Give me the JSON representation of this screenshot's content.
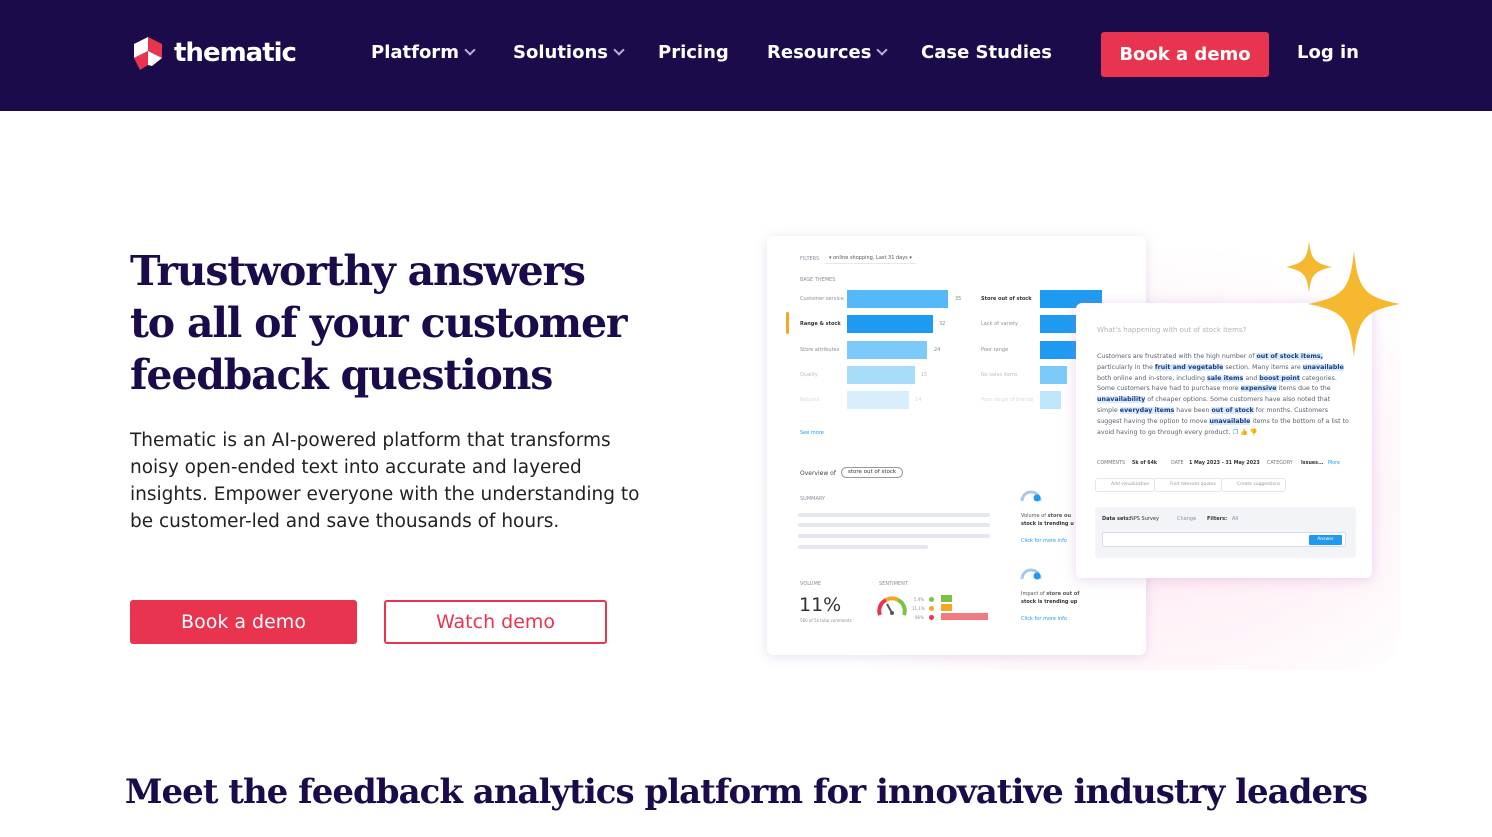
{
  "nav": {
    "logo_text": "thematic",
    "items": [
      {
        "label": "Platform",
        "dropdown": true
      },
      {
        "label": "Solutions",
        "dropdown": true
      },
      {
        "label": "Pricing",
        "dropdown": false
      },
      {
        "label": "Resources",
        "dropdown": true
      },
      {
        "label": "Case Studies",
        "dropdown": false
      }
    ],
    "book_demo": "Book a demo",
    "login": "Log in"
  },
  "hero": {
    "title_lines": [
      "Trustworthy answers",
      "to all of your customer",
      "feedback questions"
    ],
    "description": "Thematic is an AI-powered platform that transforms noisy open-ended text into accurate and layered insights. Empower everyone with the understanding to be customer-led and save thousands of hours.",
    "primary_cta": "Book a demo",
    "secondary_cta": "Watch demo"
  },
  "mockup": {
    "filters_label": "FILTERS",
    "filter_value": "▾ online shopping, Last 31 days ▾",
    "base_themes_label": "BASE THEMES",
    "themes_left": [
      {
        "label": "Customer service",
        "value": "35"
      },
      {
        "label": "Range & stock",
        "value": "32"
      },
      {
        "label": "Store attributes",
        "value": "24"
      },
      {
        "label": "Quality",
        "value": "15"
      },
      {
        "label": "Returns",
        "value": "14"
      }
    ],
    "themes_right": [
      {
        "label": "Store out of stock"
      },
      {
        "label": "Lack of variety"
      },
      {
        "label": "Poor range"
      },
      {
        "label": "No sales items"
      },
      {
        "label": "Poor range of brands"
      }
    ],
    "see_more": "See more",
    "overview_label": "Overview of",
    "overview_pill": "store out of stock",
    "summary_label": "SUMMARY",
    "volume_label": "VOLUME",
    "volume_value": "11%",
    "volume_sub": "580 of 5k total comments",
    "sentiment_label": "SENTIMENT",
    "sentiment_legend": [
      "5.9%",
      "11.1%",
      "86%"
    ],
    "insight1_a": "Volume of ",
    "insight1_b": "store ou",
    "insight1_c": "stock is trending u",
    "insight2_a": "Impact of ",
    "insight2_b": "store out of",
    "insight2_c": "stock is trending up",
    "click_more": "Click for more info"
  },
  "ai_card": {
    "question": "What's happening with out of stock items?",
    "meta": [
      "COMMENTS",
      "5k of 64k",
      "DATE",
      "1 May 2023 - 31 May 2023",
      "CATEGORY",
      "Issues...",
      "More"
    ],
    "chips": [
      "Add visualization",
      "Find relevant quotes",
      "Create suggestions"
    ],
    "dataset_label": "Data sets:",
    "dataset_value": "NPS Survey",
    "change": "Change",
    "filters_label": "Filters:",
    "filters_value": "All",
    "answer_button": "Answer"
  },
  "colors": {
    "nav_bg": "#1b0b4b",
    "accent": "#e8344e",
    "bar_blue": "#1e9bf0",
    "sparkle": "#f5b82e"
  },
  "section": {
    "title": "Meet the feedback analytics platform for innovative industry leaders"
  }
}
